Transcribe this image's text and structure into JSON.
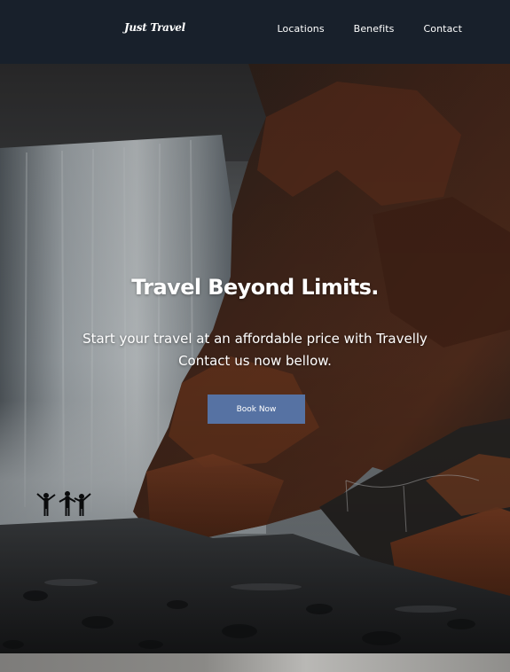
{
  "navbar": {
    "brand": "Just Travel",
    "links": [
      {
        "label": "Locations"
      },
      {
        "label": "Benefits"
      },
      {
        "label": "Contact"
      }
    ],
    "background": "#18202b"
  },
  "hero": {
    "title": "Travel Beyond Limits.",
    "subtitle_line1": "Start your travel at an affordable price with Travelly",
    "subtitle_line2": "Contact us now bellow.",
    "cta_label": "Book Now",
    "cta_color": "#5672a3",
    "background_description_icon": "waterfall-cliff-photo"
  }
}
